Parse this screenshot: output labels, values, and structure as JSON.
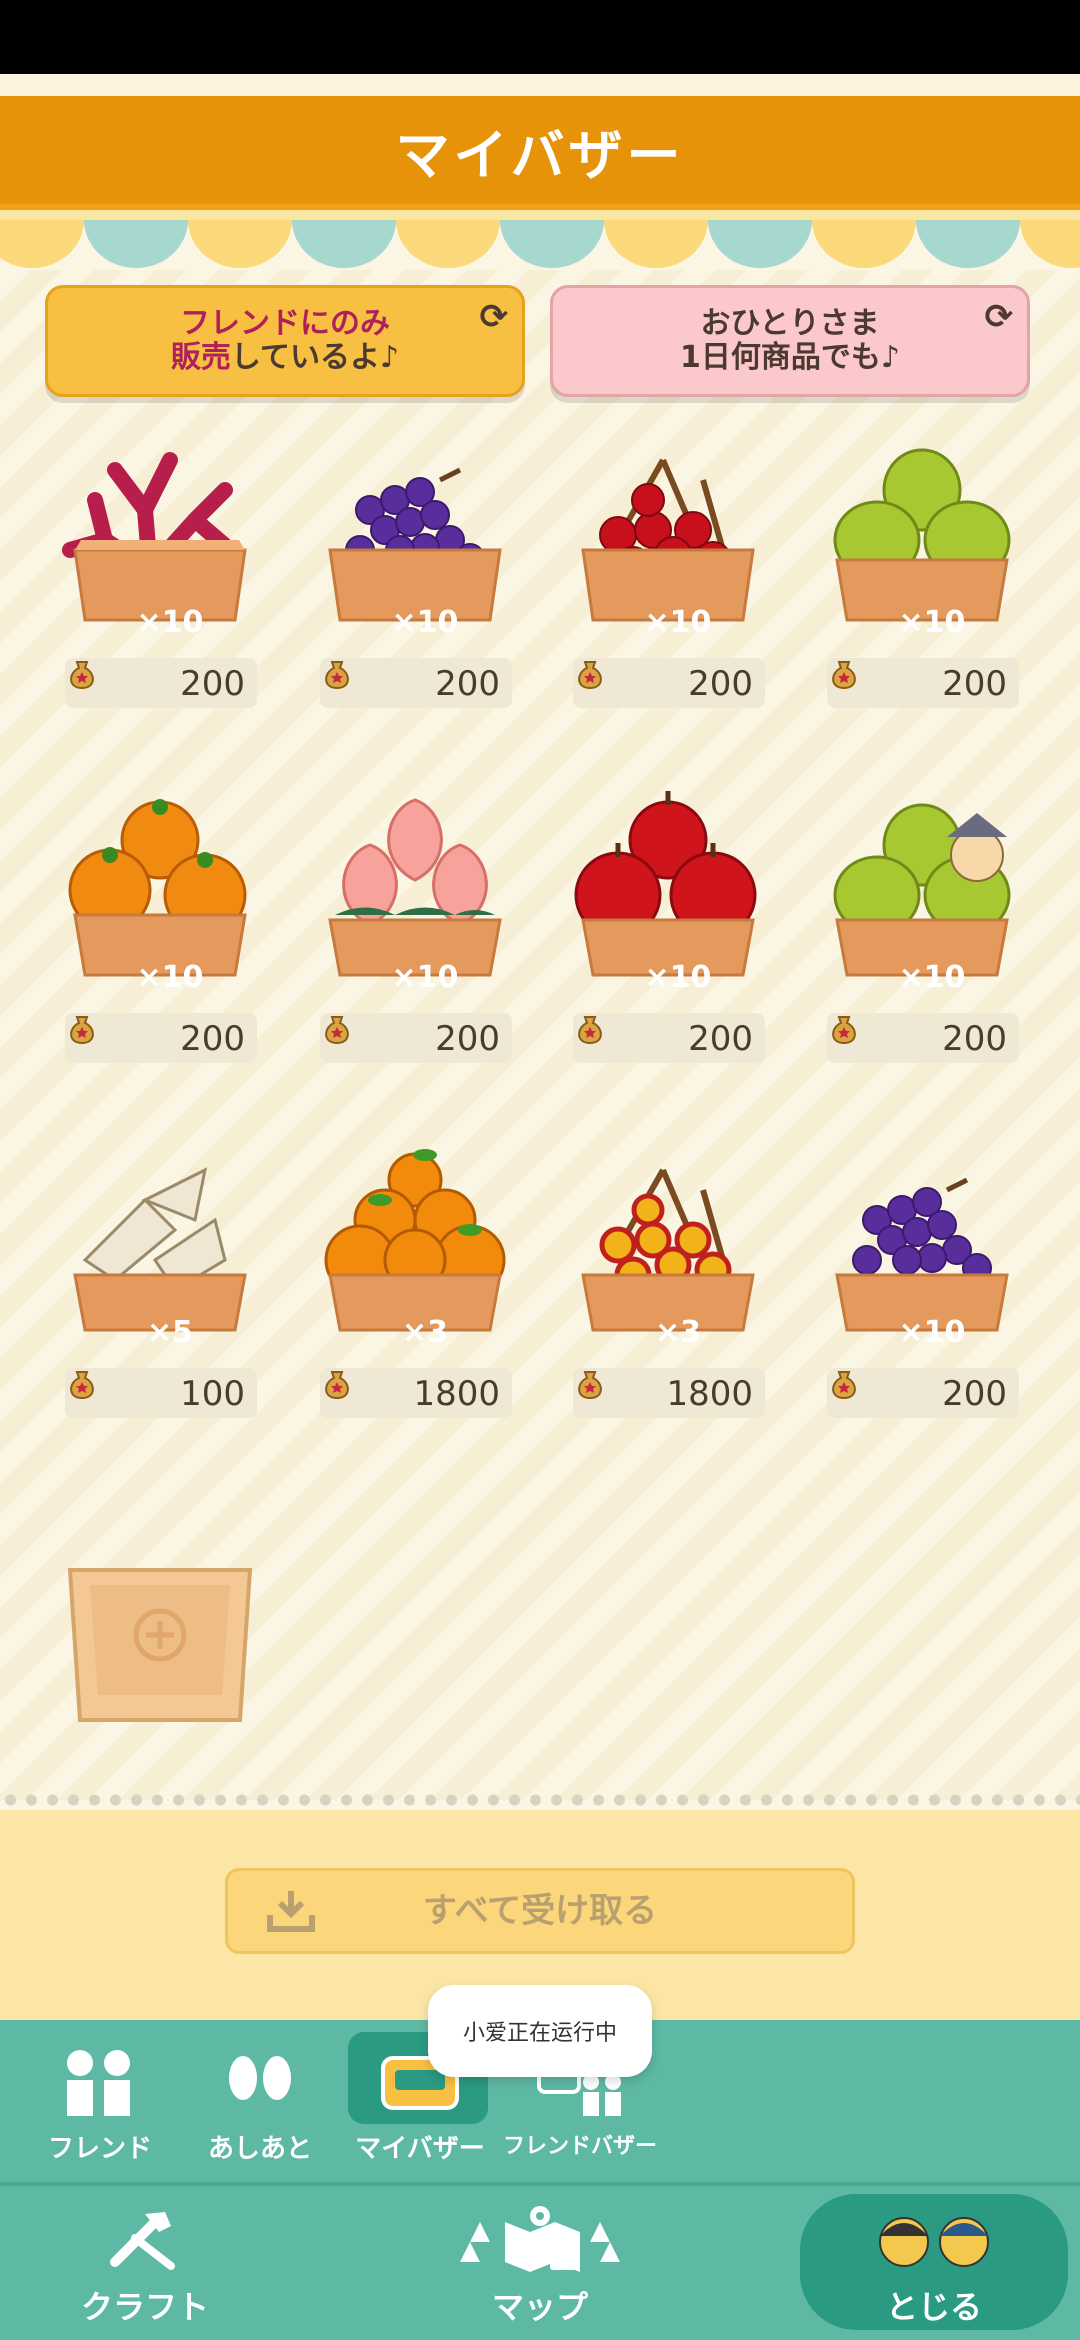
{
  "header": {
    "title": "マイバザー"
  },
  "tabs": {
    "friends": {
      "line1": "フレンドにのみ",
      "line2_red": "販売",
      "line2_rest": "しているよ♪"
    },
    "solo": {
      "line1": "おひとりさま",
      "line2": "1日何商品でも♪"
    }
  },
  "items": [
    {
      "name": "coral",
      "qty": "×10",
      "price": "200"
    },
    {
      "name": "grapes",
      "qty": "×10",
      "price": "200"
    },
    {
      "name": "cherries",
      "qty": "×10",
      "price": "200"
    },
    {
      "name": "pears",
      "qty": "×10",
      "price": "200"
    },
    {
      "name": "oranges",
      "qty": "×10",
      "price": "200"
    },
    {
      "name": "peaches",
      "qty": "×10",
      "price": "200"
    },
    {
      "name": "apples",
      "qty": "×10",
      "price": "200"
    },
    {
      "name": "pears",
      "qty": "×10",
      "price": "200"
    },
    {
      "name": "shells",
      "qty": "×5",
      "price": "100"
    },
    {
      "name": "special-oranges",
      "qty": "×3",
      "price": "1800"
    },
    {
      "name": "special-cherries",
      "qty": "×3",
      "price": "1800"
    },
    {
      "name": "grapes",
      "qty": "×10",
      "price": "200"
    }
  ],
  "collect_button": {
    "label": "すべて受け取る"
  },
  "toast": {
    "text": "小爱正在运行中"
  },
  "subnav": {
    "friend": "フレンド",
    "footprints": "あしあと",
    "my_bazaar": "マイバザー",
    "friend_bazaar": "フレンドバザー"
  },
  "bottomnav": {
    "craft": "クラフト",
    "map": "マップ",
    "close": "とじる"
  },
  "colors": {
    "header": "#e6930a",
    "nav": "#5db8a4",
    "nav_active": "#2a9a82",
    "crate": "#e49a5c"
  }
}
